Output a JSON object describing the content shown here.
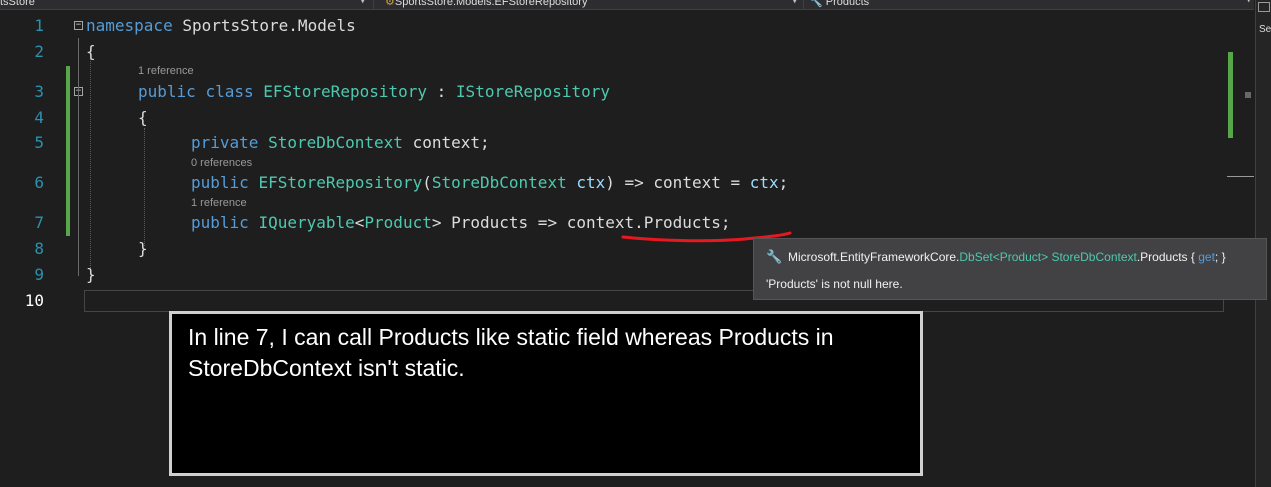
{
  "navbar": {
    "project": "tsStore",
    "namespace_path": "SportsStore.Models.EFStoreRepository",
    "member": "Products"
  },
  "line_numbers": [
    "1",
    "2",
    "3",
    "4",
    "5",
    "6",
    "7",
    "8",
    "9",
    "10"
  ],
  "code": {
    "l1_kw": "namespace",
    "l1_name": " SportsStore.Models",
    "l2": "{",
    "lens_class": "1 reference",
    "l3_kw1": "public",
    "l3_kw2": "class",
    "l3_type": "EFStoreRepository",
    "l3_sep": " : ",
    "l3_iface": "IStoreRepository",
    "l4": "{",
    "l5_kw": "private",
    "l5_type": "StoreDbContext",
    "l5_rest": " context;",
    "lens_ctor": "0 references",
    "l6_kw": "public",
    "l6_type": "EFStoreRepository",
    "l6_open": "(",
    "l6_ptype": "StoreDbContext",
    "l6_param": "ctx",
    "l6_mid": ") => context = ",
    "l6_param2": "ctx",
    "l6_end": ";",
    "lens_prop": "1 reference",
    "l7_kw": "public",
    "l7_type": "IQueryable",
    "l7_lt": "<",
    "l7_gtype": "Product",
    "l7_rest": "> Products => context.Products;",
    "l8": "}",
    "l9": "}"
  },
  "tooltip": {
    "sig_ns": "Microsoft.EntityFrameworkCore.",
    "sig_type": "DbSet",
    "sig_lt": "<",
    "sig_gtype": "Product",
    "sig_gt": "> ",
    "sig_ctx": "StoreDbContext",
    "sig_member": ".Products { ",
    "sig_get": "get",
    "sig_end": "; }",
    "note": "'Products' is not null here."
  },
  "side_tab": "Se",
  "annotation": "In line 7, I can call Products like static field whereas Products in StoreDbContext isn't static.",
  "colors": {
    "background": "#1e1e1e",
    "keyword": "#569cd6",
    "type": "#4ec9b0",
    "parameter": "#9cdcfe",
    "line_number": "#2b91af",
    "change_bar": "#57a64a",
    "red_mark": "#e8191e"
  },
  "icons": [
    "wrench-icon",
    "collapse-icon",
    "chevron-down-icon",
    "settings-icon"
  ]
}
